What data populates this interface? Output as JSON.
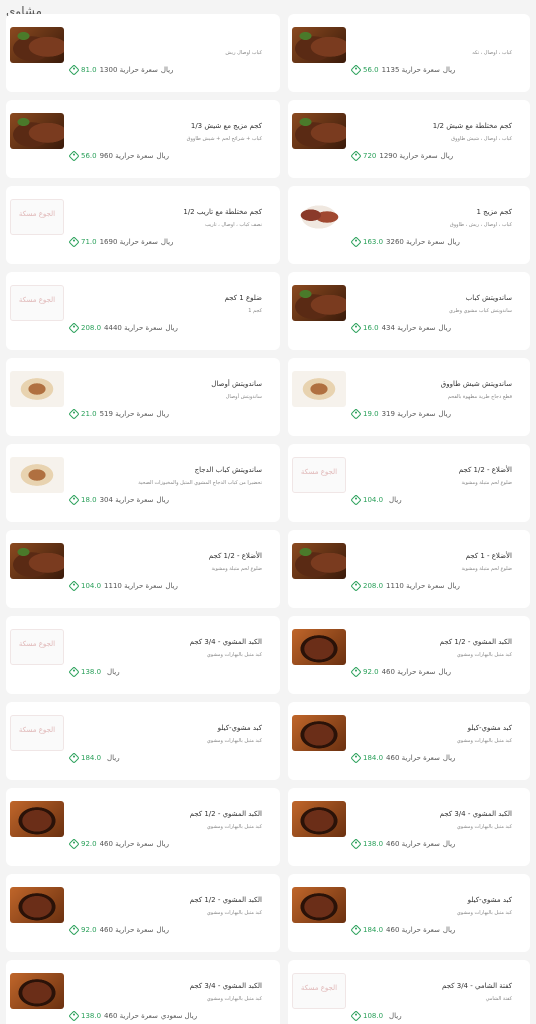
{
  "section_title": "مشاوي",
  "items": [
    {
      "name": "",
      "desc": "كباب اوصال ريش",
      "price": "81.0",
      "cal": "1300 سعرة حرارية",
      "unit": "ريال",
      "img": "steak"
    },
    {
      "name": "",
      "desc": "كباب ، اوصال ، تكه",
      "price": "56.0",
      "cal": "1135 سعرة حرارية",
      "unit": "ريال",
      "img": "steak"
    },
    {
      "name": "كجم مزيج مع شيش 1/3",
      "desc": "كباب + شرائح لحم + شيش طاووق",
      "price": "56.0",
      "cal": "960 سعرة حرارية",
      "unit": "ريال",
      "img": "steak"
    },
    {
      "name": "كجم مختلطة مع شيش 1/2",
      "desc": "كباب ، اوصال ، شيش طاووق",
      "price": "720",
      "cal": "1290 سعرة حرارية",
      "unit": "ريال",
      "img": "steak"
    },
    {
      "name": "كجم مختلطة مع تاريب 1/2",
      "desc": "نصف كباب ، اوصال ، تاريب",
      "price": "71.0",
      "cal": "1690 سعرة حرارية",
      "unit": "ريال",
      "img": "placeholder"
    },
    {
      "name": "كجم مزيج 1",
      "desc": "كباب ، اوصال ، ريش ، طاووق",
      "price": "163.0",
      "cal": "3260 سعرة حرارية",
      "unit": "ريال",
      "img": "mixed"
    },
    {
      "name": "ضلوع 1 كجم",
      "desc": "كجم 1",
      "price": "208.0",
      "cal": "4440 سعرة حرارية",
      "unit": "ريال",
      "img": "placeholder"
    },
    {
      "name": "ساندويتش كباب",
      "desc": "ساندويتش كباب مشوي وطري",
      "price": "16.0",
      "cal": "434 سعرة حرارية",
      "unit": "ريال",
      "img": "steak"
    },
    {
      "name": "ساندويتش أوصال",
      "desc": "ساندويتش أوصال",
      "price": "21.0",
      "cal": "519 سعرة حرارية",
      "unit": "ريال",
      "img": "sandwich"
    },
    {
      "name": "ساندويتش شيش طاووق",
      "desc": "قطع دجاج طرية مطهوة بالفحم",
      "price": "19.0",
      "cal": "319 سعرة حرارية",
      "unit": "ريال",
      "img": "sandwich"
    },
    {
      "name": "ساندويتش كباب الدجاج",
      "desc": "تحضيرا من كباب الدجاج المشوي المتبل والمخبوزات الصحية",
      "price": "18.0",
      "cal": "304 سعرة حرارية",
      "unit": "ريال",
      "img": "sandwich"
    },
    {
      "name": "الأضلاع - 1/2 كجم",
      "desc": "ضلوع لحم متبلة ومشوية",
      "price": "104.0",
      "cal": "",
      "unit": "ريال",
      "img": "placeholder"
    },
    {
      "name": "الأضلاع - 1/2 كجم",
      "desc": "ضلوع لحم متبلة ومشوية",
      "price": "104.0",
      "cal": "1110 سعرة حرارية",
      "unit": "ريال",
      "img": "steak"
    },
    {
      "name": "الأضلاع - 1 كجم",
      "desc": "ضلوع لحم متبلة ومشوية",
      "price": "208.0",
      "cal": "1110 سعرة حرارية",
      "unit": "ريال",
      "img": "steak"
    },
    {
      "name": "الكبد المشوي - 3/4 كجم",
      "desc": "كبد متبل بالبهارات ومشوي",
      "price": "138.0",
      "cal": "",
      "unit": "ريال",
      "img": "placeholder"
    },
    {
      "name": "الكبد المشوي - 1/2 كجم",
      "desc": "كبد متبل بالبهارات ومشوي",
      "price": "92.0",
      "cal": "460 سعرة حرارية",
      "unit": "ريال",
      "img": "liver"
    },
    {
      "name": "كبد مشوي-كيلو",
      "desc": "كبد متبل بالبهارات ومشوي",
      "price": "184.0",
      "cal": "",
      "unit": "ريال",
      "img": "placeholder"
    },
    {
      "name": "كبد مشوي-كيلو",
      "desc": "كبد متبل بالبهارات ومشوي",
      "price": "184.0",
      "cal": "460 سعرة حرارية",
      "unit": "ريال",
      "img": "liver"
    },
    {
      "name": "الكبد المشوي - 1/2 كجم",
      "desc": "كبد متبل بالبهارات ومشوي",
      "price": "92.0",
      "cal": "460 سعرة حرارية",
      "unit": "ريال",
      "img": "liver"
    },
    {
      "name": "الكبد المشوي - 3/4 كجم",
      "desc": "كبد متبل بالبهارات ومشوي",
      "price": "138.0",
      "cal": "460 سعرة حرارية",
      "unit": "ريال",
      "img": "liver"
    },
    {
      "name": "الكبد المشوي - 1/2 كجم",
      "desc": "كبد متبل بالبهارات ومشوي",
      "price": "92.0",
      "cal": "460 سعرة حرارية",
      "unit": "ريال",
      "img": "liver"
    },
    {
      "name": "كبد مشوي-كيلو",
      "desc": "كبد متبل بالبهارات ومشوي",
      "price": "184.0",
      "cal": "460 سعرة حرارية",
      "unit": "ريال",
      "img": "liver"
    },
    {
      "name": "الكبد المشوي - 3/4 كجم",
      "desc": "كبد متبل بالبهارات ومشوي",
      "price": "138.0",
      "cal": "460 سعرة حرارية",
      "unit": "ريال سعودي",
      "img": "liver"
    },
    {
      "name": "كفتة الشامي - 3/4 كجم",
      "desc": "كفتة الشامي",
      "price": "108.0",
      "cal": "",
      "unit": "ريال",
      "img": "placeholder"
    }
  ],
  "placeholder_text": "الجوع مسكة",
  "colors": {
    "price": "#2aa05a",
    "background": "#f4f4f4",
    "card": "#ffffff"
  }
}
